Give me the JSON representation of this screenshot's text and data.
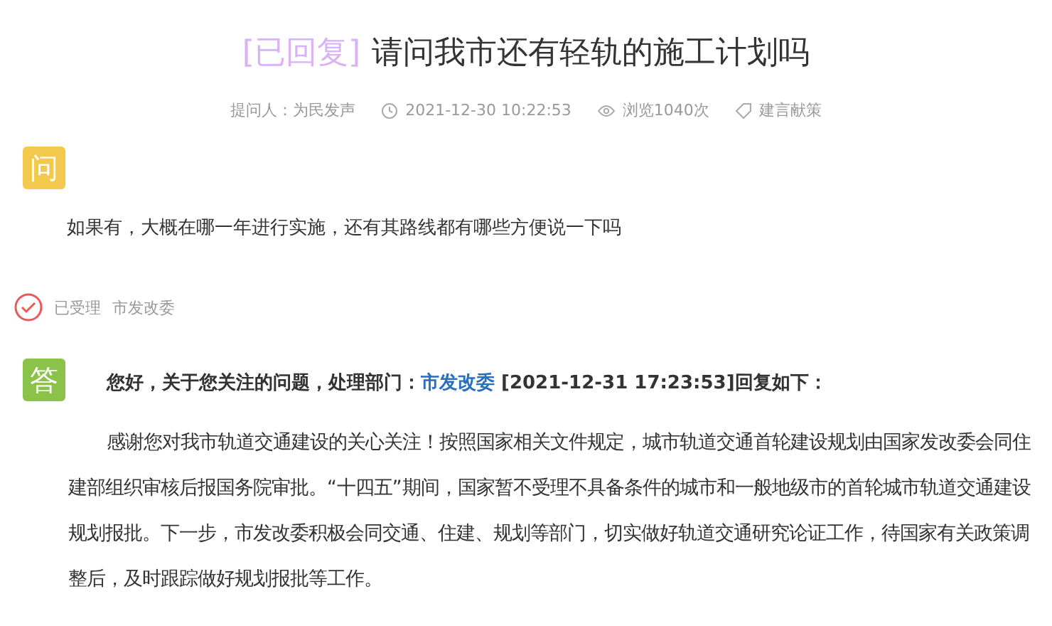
{
  "title": {
    "status": "[已回复]",
    "text": "请问我市还有轻轨的施工计划吗"
  },
  "meta": {
    "asker": "提问人：为民发声",
    "time": "2021-12-30 10:22:53",
    "views": "浏览1040次",
    "category": "建言献策"
  },
  "question": {
    "badge": "问",
    "text": "如果有，大概在哪一年进行实施，还有其路线都有哪些方便说一下吗"
  },
  "status": {
    "label": "已受理",
    "department": "市发改委"
  },
  "answer": {
    "badge": "答",
    "heading_prefix": "您好，关于您关注的问题，处理部门：",
    "department": "市发改委",
    "heading_suffix": " [2021-12-31 17:23:53]回复如下：",
    "body": "感谢您对我市轨道交通建设的关心关注！按照国家相关文件规定，城市轨道交通首轮建设规划由国家发改委会同住建部组织审核后报国务院审批。“十四五”期间，国家暂不受理不具备条件的城市和一般地级市的首轮城市轨道交通建设规划报批。下一步，市发改委积极会同交通、住建、规划等部门，切实做好轨道交通研究论证工作，待国家有关政策调整后，及时跟踪做好规划报批等工作。"
  }
}
